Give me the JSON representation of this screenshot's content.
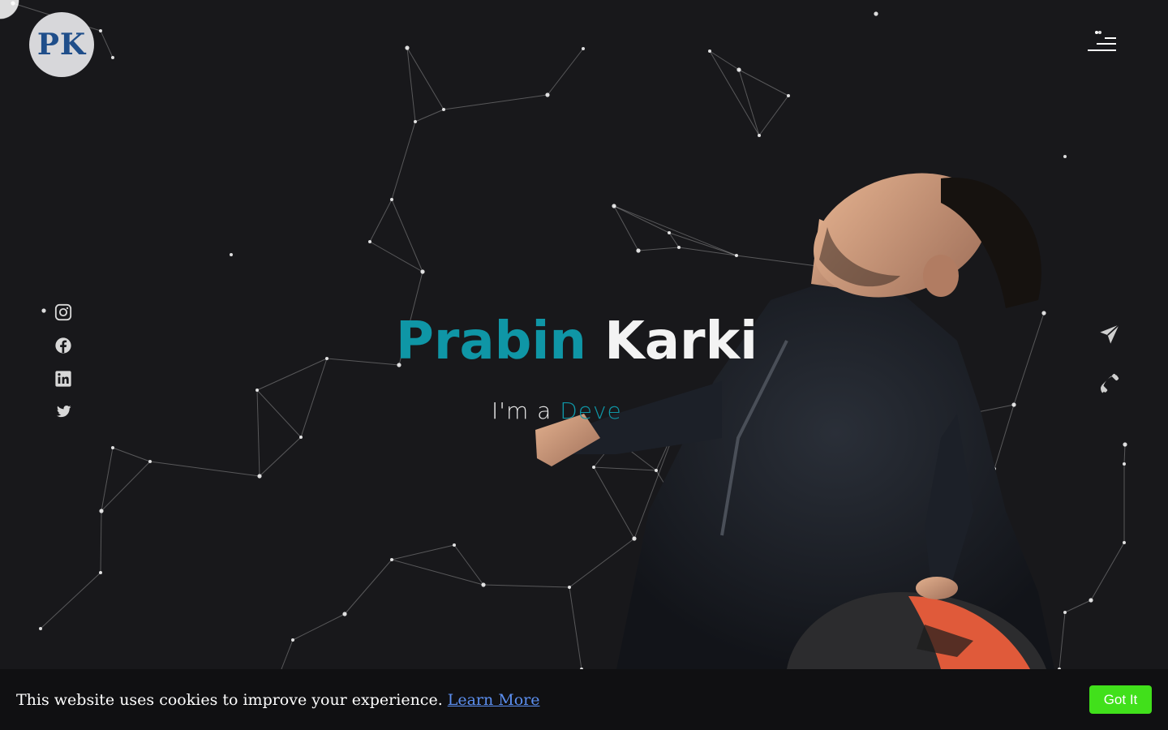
{
  "logo": {
    "text": "PK"
  },
  "hero": {
    "first_name": "Prabin",
    "last_name": "Karki",
    "tagline_prefix": "I'm a ",
    "tagline_typed": "Deve"
  },
  "social_icons": [
    "instagram-icon",
    "facebook-icon",
    "linkedin-icon",
    "twitter-icon"
  ],
  "contact_icons": [
    "send-icon",
    "phone-icon"
  ],
  "cookie": {
    "message": "This website uses cookies to improve your experience.",
    "learn_more": "Learn More",
    "accept_label": "Got It"
  },
  "colors": {
    "background": "#18181b",
    "accent": "#0f96a6",
    "name_white": "#f3f3f3",
    "cookie_button": "#41e01b",
    "link": "#5c8ff0",
    "logo_text": "#1f4e8a"
  }
}
